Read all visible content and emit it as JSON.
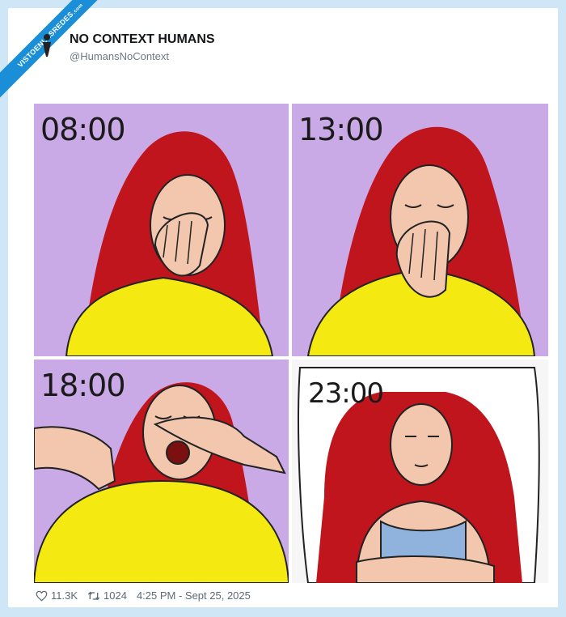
{
  "watermark": {
    "text": "VISTOENLASREDES",
    "suffix": ".com"
  },
  "tweet": {
    "author_name": "NO CONTEXT HUMANS",
    "author_handle": "@HumansNoContext",
    "likes": "11.3K",
    "retweets": "1024",
    "timestamp": "4:25 PM - Sept 25, 2025"
  },
  "panels": [
    {
      "time": "08:00"
    },
    {
      "time": "13:00"
    },
    {
      "time": "18:00"
    },
    {
      "time": "23:00"
    }
  ],
  "colors": {
    "page_bg": "#cfe6f7",
    "panel_bg": "#c9a9e6",
    "hair": "#c0151d",
    "sweater": "#f4ea12",
    "skin": "#f2c7ae",
    "tank_top": "#8fb3dd",
    "ribbon": "#1a8fd8"
  },
  "icons": [
    "heart-icon",
    "retweet-icon"
  ]
}
